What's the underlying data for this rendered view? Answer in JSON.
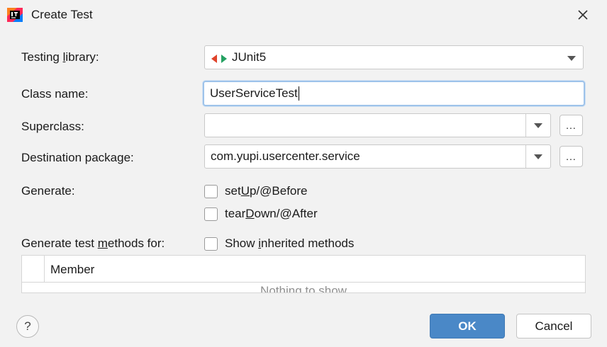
{
  "window": {
    "title": "Create Test",
    "app_icon": "intellij-idea-icon",
    "close_icon": "close-icon"
  },
  "form": {
    "testing_library": {
      "label_pre": "Testing ",
      "label_mnemonic": "l",
      "label_post": "ibrary:",
      "value": "JUnit5",
      "icon": "junit-icon"
    },
    "class_name": {
      "label": "Class name:",
      "value": "UserServiceTest"
    },
    "superclass": {
      "label": "Superclass:",
      "value": "",
      "browse_label": "..."
    },
    "destination_package": {
      "label": "Destination package:",
      "value": "com.yupi.usercenter.service",
      "browse_label": "..."
    },
    "generate": {
      "label": "Generate:",
      "options": [
        {
          "pre": "set",
          "mnemonic": "U",
          "post": "p/@Before",
          "checked": false
        },
        {
          "pre": "tear",
          "mnemonic": "D",
          "post": "own/@After",
          "checked": false
        }
      ]
    },
    "test_methods": {
      "label_pre": "Generate test ",
      "label_mnemonic": "m",
      "label_post": "ethods for:",
      "show_inherited": {
        "pre": "Show ",
        "mnemonic": "i",
        "post": "nherited methods",
        "checked": false
      }
    }
  },
  "table": {
    "column_header": "Member",
    "empty_text": "Nothing to show"
  },
  "buttons": {
    "help_label": "?",
    "ok_label": "OK",
    "cancel_label": "Cancel"
  },
  "colors": {
    "primary_button": "#4a88c7",
    "focus_border": "#9ec3ea",
    "background": "#f2f2f2"
  }
}
